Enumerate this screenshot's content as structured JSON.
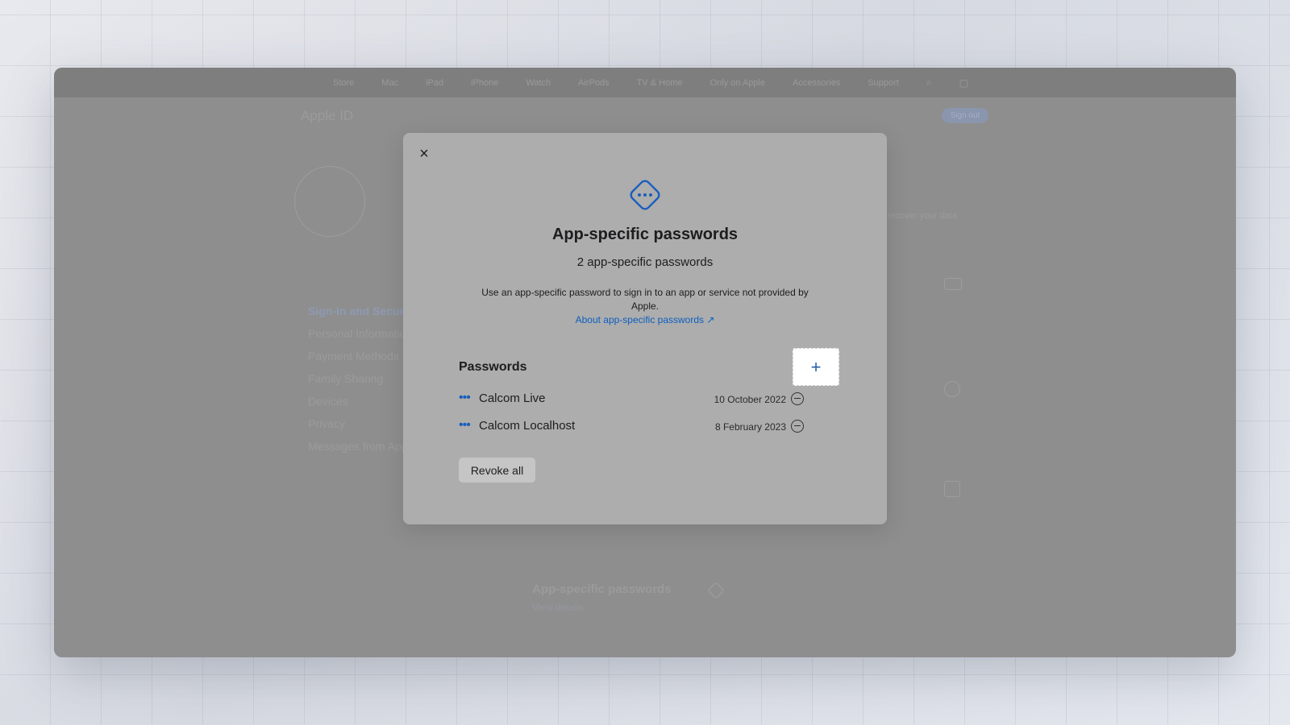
{
  "background": {
    "nav": {
      "items": [
        "Store",
        "Mac",
        "iPad",
        "iPhone",
        "Watch",
        "AirPods",
        "TV & Home",
        "Only on Apple",
        "Accessories",
        "Support"
      ]
    },
    "page_title": "Apple ID",
    "sign_out_label": "Sign out",
    "sidebar": {
      "items": [
        "Sign-In and Security",
        "Personal Information",
        "Payment Methods",
        "Family Sharing",
        "Devices",
        "Privacy",
        "Messages from Apple"
      ]
    },
    "recover_text": "recover your data",
    "card_title": "App-specific passwords",
    "card_link": "View details"
  },
  "modal": {
    "close_icon": "×",
    "title": "App-specific passwords",
    "subtitle": "2 app-specific passwords",
    "description": "Use an app-specific password to sign in to an app or service not provided by Apple.",
    "about_link": "About app-specific passwords ↗",
    "section_label": "Passwords",
    "add_label": "+",
    "passwords": [
      {
        "name": "Calcom Live",
        "date": "10 October 2022"
      },
      {
        "name": "Calcom Localhost",
        "date": "8 February 2023"
      }
    ],
    "revoke_all_label": "Revoke all"
  },
  "colors": {
    "accent": "#1a5fbd",
    "overlay": "#8e8e8e",
    "modal_bg": "#adadad"
  }
}
